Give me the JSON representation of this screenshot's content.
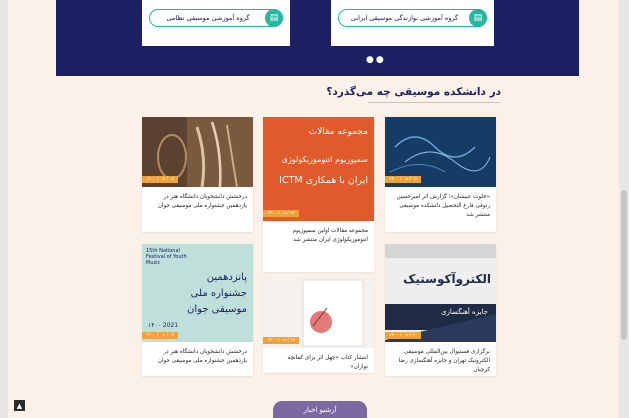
{
  "groups": {
    "left_label": "گروه آموزشی موسیقی نظامی",
    "right_label": "گروه آموزشی نوازندگی موسیقی ایرانی",
    "icon": "building-icon"
  },
  "section": {
    "title": "در دانشکده موسیقی چه می‌گذرد؟"
  },
  "cards": [
    {
      "badge": "۱۴۰۰ / ۰۸ / ۱۶",
      "caption": "«خلوت عبیشان»؛ گزارش اثر امیرحسین رتوقی فارغ التحصیل دانشکده موسیقی منتشر شد"
    },
    {
      "badge": "۱۴۰۰ / ۰۸ / ۲۴",
      "caption": "مجموعه مقالات اولین سمپوزیوم اتنوموزیکولوژی ایران منتشر شد",
      "poster_title": "مجموعه مقالات",
      "poster_line1": "سمپوزیوم اتنوموزیکولوژی",
      "poster_line2": "ایران با همکاری ICTM"
    },
    {
      "badge": "۱۴۰۰ / ۰۸ / ۰۲",
      "caption": "درخشش دانشجویان دانشگاه هنر در یازدهمین جشنواره ملی موسیقی جوان"
    },
    {
      "badge": "۱۴۰۰ / ۰۸ / ۲۰",
      "caption": "برگزاری فستیوال بین‌المللی موسیقی الکترونیک تهران و جایزه آهنگسازی رضا کرچیان",
      "poster_line1": "الکتروآکوستیک",
      "poster_sub": "جایزه آهنگسازی"
    },
    {
      "badge": "۱۴۰۰ / ۰۸ / ۱۸",
      "caption": "انتشار کتاب «چهل اثر برای کمانچه نوازان»"
    },
    {
      "badge": "۱۴۰۰ / ۰۸ / ۰۴",
      "caption": "درخشش دانشجویان دانشگاه هنر در یازدهمین جشنواره ملی موسیقی جوان",
      "poster_en": "15th National Festival of Youth Music",
      "poster_fa1": "پانزدهمین",
      "poster_fa2": "جشنواره ملی",
      "poster_fa3": "موسیقی جوان",
      "poster_year": "۱۴۰۰ 2021"
    }
  ],
  "footer": {
    "archive_label": "آرشیو اخبار",
    "back_to_top": "▲"
  },
  "colors": {
    "navy": "#1b2062",
    "teal": "#29b6a0",
    "badge": "#f0a23a",
    "archive": "#7a6aa0"
  }
}
